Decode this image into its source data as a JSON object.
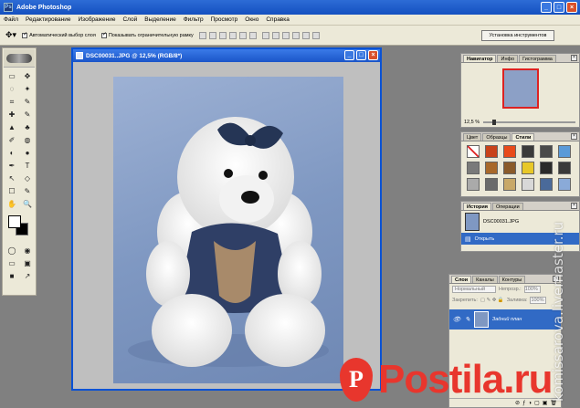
{
  "app": {
    "title": "Adobe Photoshop",
    "logo_text": "Ps"
  },
  "window_controls": {
    "minimize": "_",
    "maximize": "□",
    "close": "×"
  },
  "menu": [
    "Файл",
    "Редактирование",
    "Изображение",
    "Слой",
    "Выделение",
    "Фильтр",
    "Просмотр",
    "Окно",
    "Справка"
  ],
  "options": {
    "auto_select": "Автоматический выбор слоя",
    "show_bounds": "Показывать ограничительную рамку",
    "workspace_button": "Установка инструментов"
  },
  "document": {
    "title": "DSC00031..JPG @ 12,5% (RGB/8*)"
  },
  "toolbox": {
    "tools": [
      "▭",
      "✥",
      "◌",
      "✦",
      "⌗",
      "✎",
      "✚",
      "✎",
      "▲",
      "♣",
      "✐",
      "◍",
      "◐",
      "●",
      "✒",
      "T",
      "↖",
      "◇",
      "☐",
      "✎",
      "✋",
      "🔍",
      "◯",
      "◉"
    ]
  },
  "panels": {
    "navigator": {
      "tabs": [
        "Навигатор",
        "Инфо",
        "Гистограмма"
      ],
      "zoom": "12,5 %"
    },
    "styles": {
      "tabs": [
        "Цвет",
        "Образцы",
        "Стили"
      ],
      "swatch_colors": [
        "#ffffff",
        "#c8421a",
        "#e84a1a",
        "#3a3a3a",
        "#4a4a4a",
        "#5a9ad8",
        "#7a7a7a",
        "#a8682a",
        "#8a5a2a",
        "#e8c828",
        "#2a2a2a",
        "#3a3a3a",
        "#aaaaaa",
        "#6a6a6a",
        "#c8a868",
        "#d8d8d8",
        "#4a6a9a",
        "#8aaad8"
      ]
    },
    "history": {
      "tabs": [
        "История",
        "Операции"
      ],
      "snapshot": "DSC00031.JPG",
      "step": "Открыть"
    },
    "layers": {
      "tabs": [
        "Слои",
        "Каналы",
        "Контуры"
      ],
      "blend_mode": "Нормальный",
      "opacity_label": "Непрозр.:",
      "opacity_value": "100%",
      "lock_label": "Закрепить:",
      "fill_label": "Заливка:",
      "fill_value": "100%",
      "layer_name": "Задний план",
      "footer_icons": [
        "⊘",
        "ƒ",
        "◑",
        "▢",
        "▣",
        "🗑"
      ]
    }
  },
  "watermark": "komissarova.livemaster.ru",
  "banner": {
    "pin_letter": "P",
    "text": "Postila.ru"
  }
}
